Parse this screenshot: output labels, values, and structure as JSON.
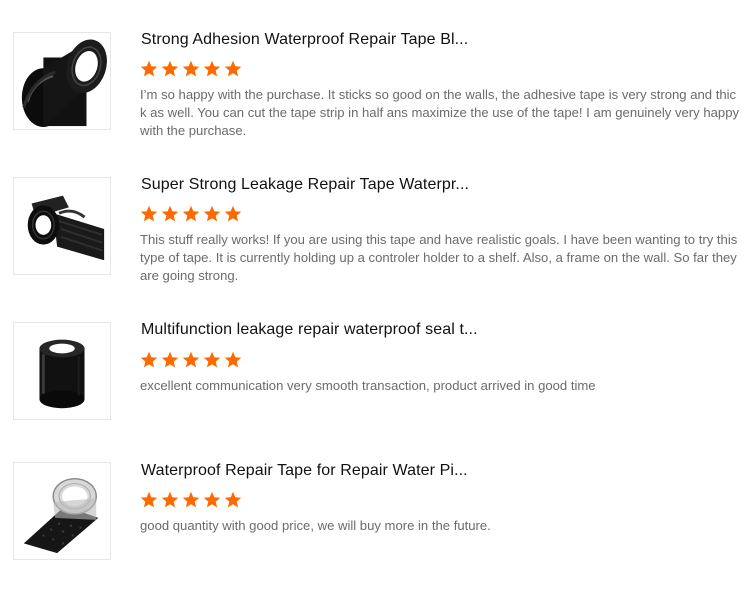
{
  "reviews": [
    {
      "title": "Strong Adhesion Waterproof Repair Tape Bl...",
      "rating": 5,
      "text": "I’m so happy with the purchase. It sticks so good on the walls, the adhesive tape is very strong and thick as well. You can cut the tape strip in half ans maximize the use of the tape! I am genuinely very happy with the purchase.",
      "image_icon": "black-tape-roll-image"
    },
    {
      "title": "Super Strong Leakage Repair Tape Waterpr...",
      "rating": 5,
      "text": "This stuff really works! If you are using this tape and have realistic goals. I have been wanting to try this type of tape. It is currently holding up a controler holder to a shelf. Also, a frame on the wall. So far they are going strong.",
      "image_icon": "unrolled-black-tape-image"
    },
    {
      "title": "Multifunction leakage repair waterproof seal t...",
      "rating": 5,
      "text": "excellent communication very smooth transaction, product arrived in good time",
      "image_icon": "black-tape-roll-image"
    },
    {
      "title": "Waterproof Repair Tape for Repair Water Pi...",
      "rating": 5,
      "text": "good quantity with good price, we will buy more in the future.",
      "image_icon": "textured-tape-roll-image"
    }
  ],
  "colors": {
    "star": "#ff6a00",
    "title": "#111111",
    "text": "#6b6b6b"
  }
}
